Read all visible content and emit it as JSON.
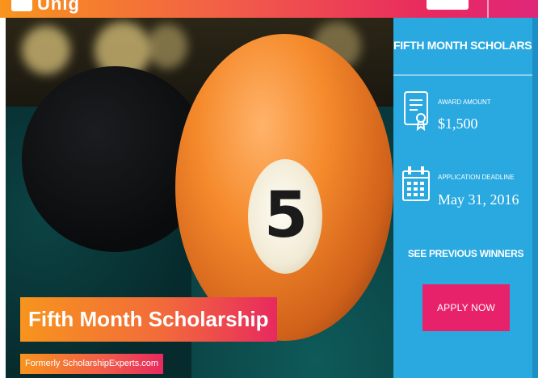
{
  "header": {
    "logo_text": "Unig"
  },
  "hero": {
    "ball_number": "5",
    "title": "Fifth Month Scholarship",
    "subtitle": "Formerly ScholarshipExperts.com"
  },
  "sidebar": {
    "title": "FIFTH MONTH SCHOLARSHIP",
    "award": {
      "label": "AWARD AMOUNT",
      "value": "$1,500",
      "icon": "certificate-icon"
    },
    "deadline": {
      "label": "APPLICATION DEADLINE",
      "value": "May 31, 2016",
      "icon": "calendar-icon"
    },
    "previous_winners_label": "SEE PREVIOUS WINNERS",
    "apply_label": "APPLY NOW"
  },
  "colors": {
    "sidebar_blue": "#29a9e0",
    "apply_pink": "#e8226a",
    "gradient_orange": "#f7941d",
    "gradient_pink": "#e8295f"
  }
}
